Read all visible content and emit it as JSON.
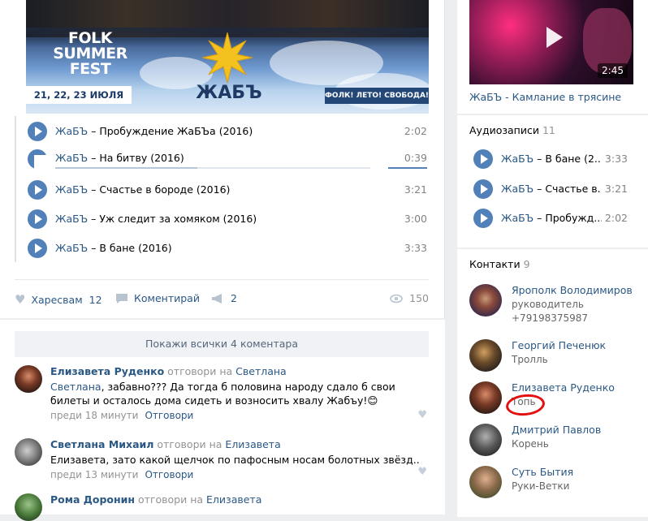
{
  "post": {
    "banner": {
      "fest_text": "FOLK SUMMER FEST",
      "dates": "21, 22, 23 ИЮЛЯ",
      "band_name": "ЖАБЪ",
      "slogan": "ФОЛК! ЛЕТО! СВОБОДА!"
    },
    "tracks": [
      {
        "artist": "ЖаБЪ",
        "sep": " – ",
        "title": "Пробуждение ЖаБЪа (2016)",
        "duration": "2:02",
        "state": "paused"
      },
      {
        "artist": "ЖаБЪ",
        "sep": " – ",
        "title": "На битву (2016)",
        "duration": "0:39",
        "state": "playing"
      },
      {
        "artist": "ЖаБЪ",
        "sep": " – ",
        "title": "Счастье в бороде (2016)",
        "duration": "3:21",
        "state": "paused"
      },
      {
        "artist": "ЖаБЪ",
        "sep": " – ",
        "title": "Уж следит за хомяком (2016)",
        "duration": "3:00",
        "state": "paused"
      },
      {
        "artist": "ЖаБЪ",
        "sep": " – ",
        "title": "В бане (2016)",
        "duration": "3:33",
        "state": "paused"
      }
    ],
    "progress_fraction": 0.45,
    "actions": {
      "like_label": "Харесвам",
      "like_count": "12",
      "comment_label": "Коментирай",
      "share_count": "2",
      "views": "150"
    }
  },
  "comments": {
    "show_all": "Покажи всички 4 коментара",
    "items": [
      {
        "author": "Елизавета Руденко",
        "replied": " отговори на ",
        "to": "Светлана",
        "mention": "Светлана",
        "text": ", забавно??? Да тогда б половина народу сдало б свои билеты и осталось дома сидеть и возносить хвалу Жабъу!😊",
        "time": "преди 18 минути",
        "reply": "Отговори"
      },
      {
        "author": "Светлана Михаил",
        "replied": " отговори на ",
        "to": "Елизавета",
        "mention": "Елизавета",
        "text": ", зато какой щелчок по пафосным носам болотных звёзд..",
        "time": "преди 13 минути",
        "reply": "Отговори"
      },
      {
        "author": "Рома Доронин",
        "replied": " отговори на ",
        "to": "Елизавета"
      }
    ]
  },
  "sidebar": {
    "video": {
      "duration": "2:45",
      "title": "ЖаБЪ - Камлание в трясине"
    },
    "audio": {
      "heading": "Аудиозаписи",
      "count": "11",
      "tracks": [
        {
          "artist": "ЖаБЪ",
          "sep": " – ",
          "title": "В бане (2...",
          "duration": "3:33"
        },
        {
          "artist": "ЖаБЪ",
          "sep": " – ",
          "title": "Счастье в...",
          "duration": "3:21"
        },
        {
          "artist": "ЖаБЪ",
          "sep": " – ",
          "title": "Пробужд...",
          "duration": "2:02"
        }
      ]
    },
    "contacts": {
      "heading": "Контакти",
      "count": "9",
      "items": [
        {
          "name": "Ярополк Володимиров",
          "role": "руководитель",
          "phone": "+79198375987"
        },
        {
          "name": "Георгий Печенюк",
          "role": "Тролль"
        },
        {
          "name": "Елизавета Руденко",
          "role": "Топь"
        },
        {
          "name": "Дмитрий Павлов",
          "role": "Корень"
        },
        {
          "name": "Суть Бытия",
          "role": "Руки-Ветки"
        }
      ]
    }
  },
  "colors": {
    "link": "#2a5885",
    "accent": "#5181b8",
    "annotation": "#e41010"
  }
}
